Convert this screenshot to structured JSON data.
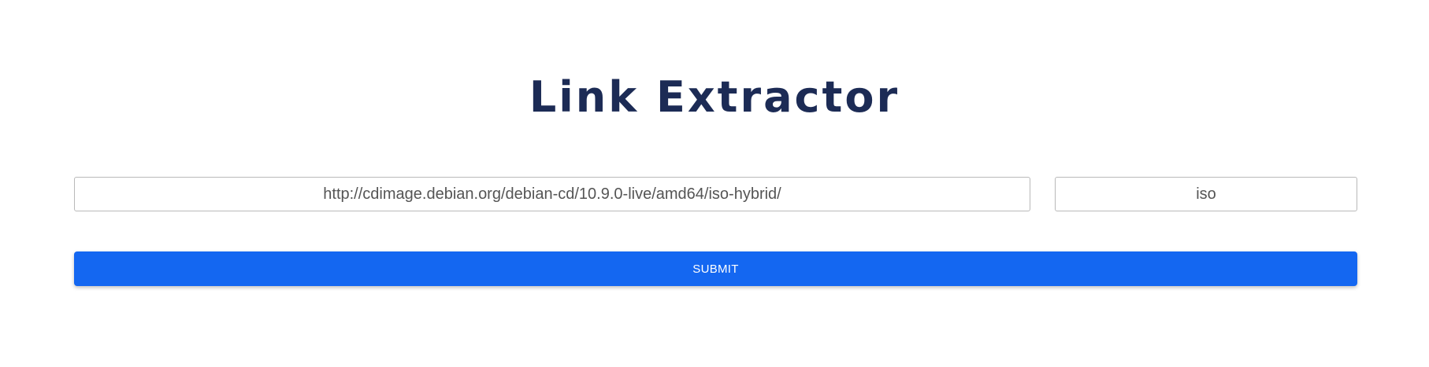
{
  "page": {
    "title": "Link Extractor"
  },
  "form": {
    "url_value": "http://cdimage.debian.org/debian-cd/10.9.0-live/amd64/iso-hybrid/",
    "extension_value": "iso",
    "submit_label": "SUBMIT"
  },
  "colors": {
    "title": "#1c2b55",
    "submit_background": "#1467f1",
    "submit_text": "#ffffff"
  }
}
